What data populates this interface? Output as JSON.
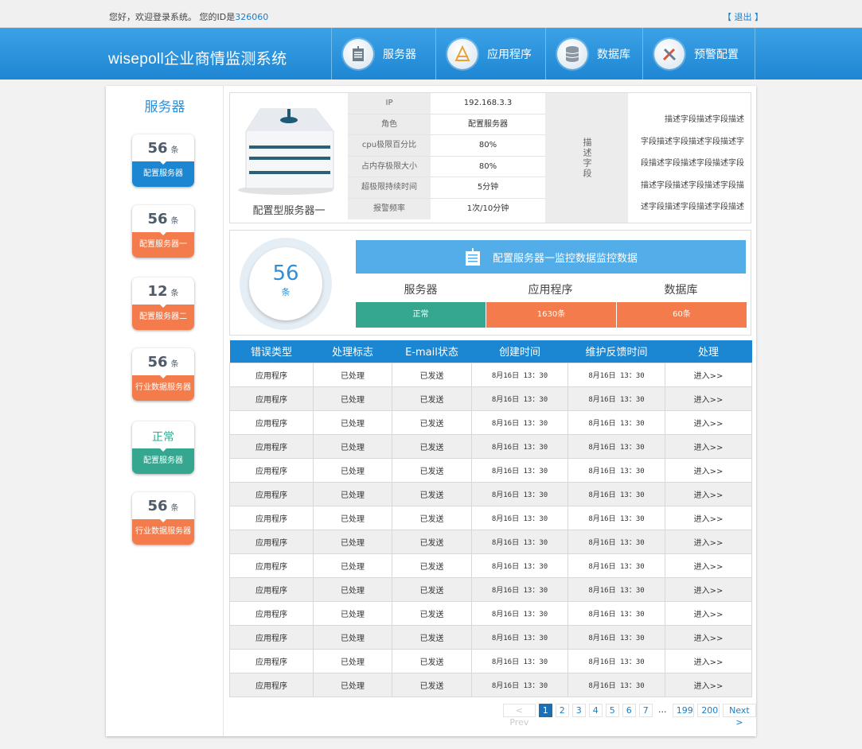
{
  "topbar": {
    "welcome": "您好，欢迎登录系统。 您的ID是",
    "user_id": "326060",
    "logout": "【 退出 】"
  },
  "header": {
    "brand": "wisepoll企业商情监测系统",
    "nav": [
      {
        "label": "服务器",
        "icon": "server-doc-icon"
      },
      {
        "label": "应用程序",
        "icon": "compass-icon"
      },
      {
        "label": "数据库",
        "icon": "database-icon"
      },
      {
        "label": "预警配置",
        "icon": "tools-icon"
      }
    ]
  },
  "sidebar": {
    "title": "服务器",
    "cards": [
      {
        "count": "56",
        "unit": "条",
        "label": "配置服务器",
        "color": "#1b86d1"
      },
      {
        "count": "56",
        "unit": "条",
        "label": "配置服务器一",
        "color": "#f47b4b"
      },
      {
        "count": "12",
        "unit": "条",
        "label": "配置服务器二",
        "color": "#f47b4b"
      },
      {
        "count": "56",
        "unit": "条",
        "label": "行业数据服务器",
        "color": "#f47b4b"
      },
      {
        "status": "正常",
        "label": "配置服务器",
        "color": "#35a68f"
      },
      {
        "count": "56",
        "unit": "条",
        "label": "行业数据服务器",
        "color": "#f47b4b"
      }
    ]
  },
  "server": {
    "name": "配置型服务器一",
    "specs": [
      {
        "key": "IP",
        "value": "192.168.3.3"
      },
      {
        "key": "角色",
        "value": "配置服务器"
      },
      {
        "key": "cpu极限百分比",
        "value": "80%"
      },
      {
        "key": "占内存极限大小",
        "value": "80%"
      },
      {
        "key": "超极限持续时间",
        "value": "5分钟"
      },
      {
        "key": "报警频率",
        "value": "1次/10分钟"
      }
    ],
    "desc_label": "描述字段",
    "desc_lines": [
      "描述字段描述字段描述",
      "字段描述字段描述字段描述字",
      "段描述字段描述字段描述字段",
      "描述字段描述字段描述字段描",
      "述字段描述字段描述字段描述"
    ]
  },
  "monitor": {
    "count": "56",
    "unit": "条",
    "title": "配置服务器一监控数据监控数据",
    "columns": [
      {
        "label": "服务器",
        "value": "正常",
        "color": "#35a68f"
      },
      {
        "label": "应用程序",
        "value": "1630条",
        "color": "#f47b4b"
      },
      {
        "label": "数据库",
        "value": "60条",
        "color": "#f47b4b"
      }
    ]
  },
  "table": {
    "headers": [
      "错误类型",
      "处理标志",
      "E-mail状态",
      "创建时间",
      "维护反馈时间",
      "处理"
    ],
    "rows": [
      [
        "应用程序",
        "已处理",
        "已发送",
        "8月16日 13：30",
        "8月16日 13：30",
        "进入>>"
      ],
      [
        "应用程序",
        "已处理",
        "已发送",
        "8月16日 13：30",
        "8月16日 13：30",
        "进入>>"
      ],
      [
        "应用程序",
        "已处理",
        "已发送",
        "8月16日 13：30",
        "8月16日 13：30",
        "进入>>"
      ],
      [
        "应用程序",
        "已处理",
        "已发送",
        "8月16日 13：30",
        "8月16日 13：30",
        "进入>>"
      ],
      [
        "应用程序",
        "已处理",
        "已发送",
        "8月16日 13：30",
        "8月16日 13：30",
        "进入>>"
      ],
      [
        "应用程序",
        "已处理",
        "已发送",
        "8月16日 13：30",
        "8月16日 13：30",
        "进入>>"
      ],
      [
        "应用程序",
        "已处理",
        "已发送",
        "8月16日 13：30",
        "8月16日 13：30",
        "进入>>"
      ],
      [
        "应用程序",
        "已处理",
        "已发送",
        "8月16日 13：30",
        "8月16日 13：30",
        "进入>>"
      ],
      [
        "应用程序",
        "已处理",
        "已发送",
        "8月16日 13：30",
        "8月16日 13：30",
        "进入>>"
      ],
      [
        "应用程序",
        "已处理",
        "已发送",
        "8月16日 13：30",
        "8月16日 13：30",
        "进入>>"
      ],
      [
        "应用程序",
        "已处理",
        "已发送",
        "8月16日 13：30",
        "8月16日 13：30",
        "进入>>"
      ],
      [
        "应用程序",
        "已处理",
        "已发送",
        "8月16日 13：30",
        "8月16日 13：30",
        "进入>>"
      ],
      [
        "应用程序",
        "已处理",
        "已发送",
        "8月16日 13：30",
        "8月16日 13：30",
        "进入>>"
      ],
      [
        "应用程序",
        "已处理",
        "已发送",
        "8月16日 13：30",
        "8月16日 13：30",
        "进入>>"
      ]
    ]
  },
  "pagination": {
    "prev": "< Prev",
    "pages": [
      "1",
      "2",
      "3",
      "4",
      "5",
      "6",
      "7",
      "...",
      "199",
      "200"
    ],
    "active": "1",
    "next": "Next >"
  },
  "colors": {
    "accent_blue": "#1b86d1",
    "orange": "#f47b4b",
    "green": "#35a68f"
  }
}
